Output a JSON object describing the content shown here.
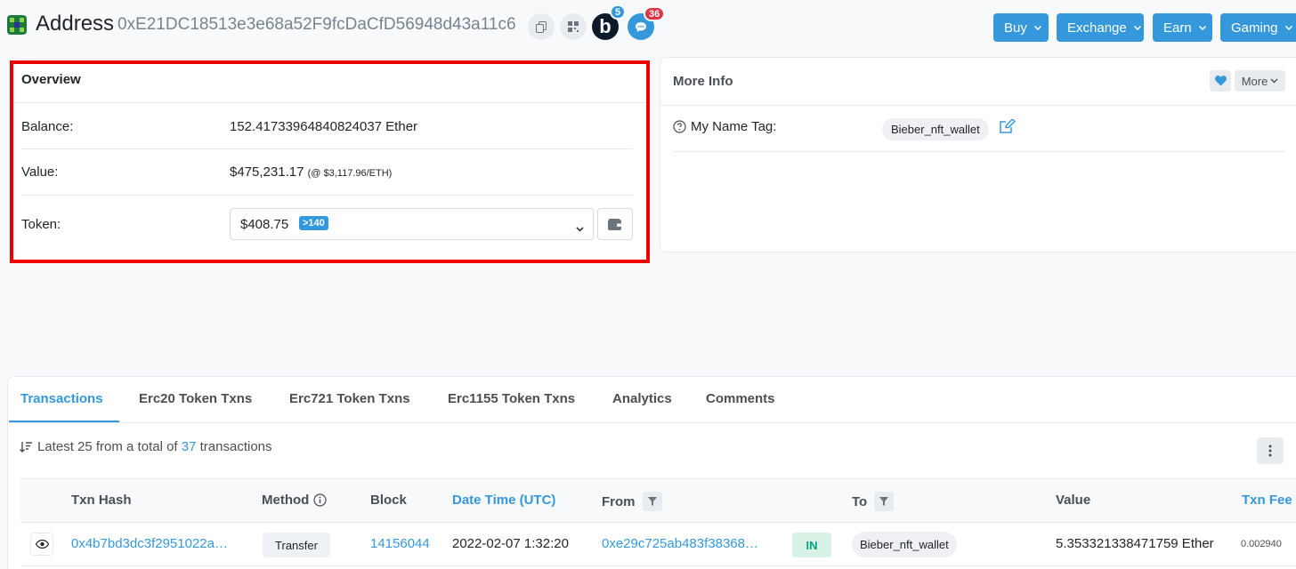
{
  "header": {
    "title": "Address",
    "address": "0xE21DC18513e3e68a52F9fcDaCfD56948d43a11c6",
    "blockscan_letter": "b",
    "blockscan_count": "5",
    "chat_count": "36",
    "nav": [
      {
        "label": "Buy"
      },
      {
        "label": "Exchange"
      },
      {
        "label": "Earn"
      },
      {
        "label": "Gaming"
      }
    ]
  },
  "overview": {
    "heading": "Overview",
    "balance_label": "Balance:",
    "balance_value": "152.41733964840824037 Ether",
    "value_label": "Value:",
    "value_amount": "$475,231.17",
    "value_rate": "(@ $3,117.96/ETH)",
    "token_label": "Token:",
    "token_amount": "$408.75",
    "token_count": ">140"
  },
  "more_info": {
    "heading": "More Info",
    "more_label": "More",
    "name_tag_label": "My Name Tag:",
    "name_tag_value": "Bieber_nft_wallet"
  },
  "tabs": [
    {
      "label": "Transactions",
      "active": true
    },
    {
      "label": "Erc20 Token Txns"
    },
    {
      "label": "Erc721 Token Txns"
    },
    {
      "label": "Erc1155 Token Txns"
    },
    {
      "label": "Analytics"
    },
    {
      "label": "Comments"
    }
  ],
  "summary": {
    "prefix": "Latest 25 from a total of",
    "count": "37",
    "suffix": "transactions"
  },
  "table": {
    "headers": {
      "txn_hash": "Txn Hash",
      "method": "Method",
      "block": "Block",
      "date_time": "Date Time (UTC)",
      "from": "From",
      "to": "To",
      "value": "Value",
      "txn_fee": "Txn Fee"
    },
    "rows": [
      {
        "hash": "0x4b7bd3dc3f2951022a…",
        "method": "Transfer",
        "block": "14156044",
        "date": "2022-02-07 1:32:20",
        "from": "0xe29c725ab483f38368…",
        "direction": "IN",
        "to": "Bieber_nft_wallet",
        "value": "5.353321338471759 Ether",
        "fee": "0.002940"
      }
    ]
  },
  "colors": {
    "accent": "#3498db",
    "highlight_frame": "#ee0000",
    "in_badge": "#00a186"
  }
}
